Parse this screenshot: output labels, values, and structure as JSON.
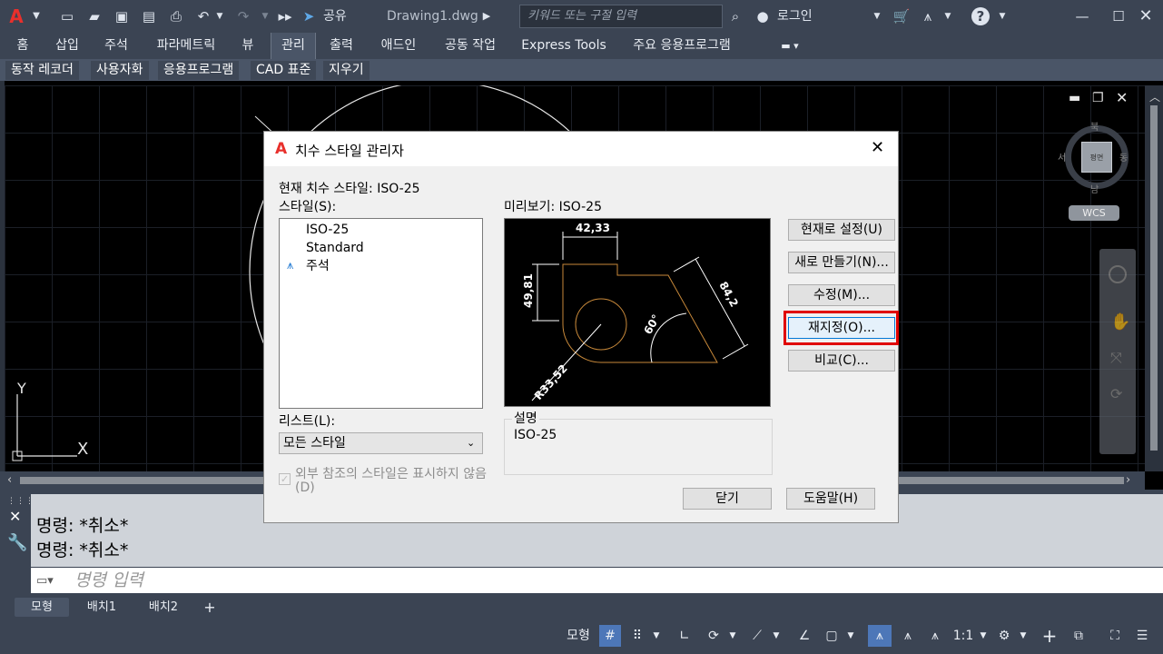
{
  "titlebar": {
    "share_label": "공유",
    "filename": "Drawing1.dwg",
    "search_placeholder": "키워드 또는 구절 입력",
    "login_label": "로그인"
  },
  "menu_tabs": [
    "홈",
    "삽입",
    "주석",
    "파라메트릭",
    "뷰",
    "관리",
    "출력",
    "애드인",
    "공동 작업",
    "Express Tools",
    "주요 응용프로그램"
  ],
  "ribbon_items": [
    "동작 레코더",
    "사용자화",
    "응용프로그램",
    "CAD 표준",
    "지우기"
  ],
  "viewcube": {
    "north": "북",
    "south": "남",
    "west": "서",
    "east": "동",
    "top_label": "평면",
    "wcs": "WCS"
  },
  "ucs": {
    "y_label": "Y",
    "x_label": "X"
  },
  "dialog": {
    "title": "치수 스타일 관리자",
    "current_style_label": "현재 치수 스타일: ISO-25",
    "styles_label": "스타일(S):",
    "styles": [
      "ISO-25",
      "Standard",
      "주석"
    ],
    "preview_label": "미리보기: ISO-25",
    "list_label": "리스트(L):",
    "list_value": "모든 스타일",
    "xref_checkbox": "외부 참조의 스타일은 표시하지 않음(D)",
    "description_label": "설명",
    "description_value": "ISO-25",
    "buttons": {
      "set_current": "현재로 설정(U)",
      "new": "새로 만들기(N)...",
      "modify": "수정(M)...",
      "override": "재지정(O)...",
      "compare": "비교(C)...",
      "close": "닫기",
      "help": "도움말(H)"
    },
    "preview_dims": {
      "top": "42,33",
      "left": "49,81",
      "diag": "84,2",
      "angle": "60°",
      "radius": "R33,52"
    }
  },
  "command": {
    "history": [
      "명령: *취소*",
      "명령: *취소*"
    ],
    "input_placeholder": "명령 입력"
  },
  "layout_tabs": [
    "모형",
    "배치1",
    "배치2"
  ],
  "status": {
    "model": "모형",
    "scale": "1:1"
  }
}
